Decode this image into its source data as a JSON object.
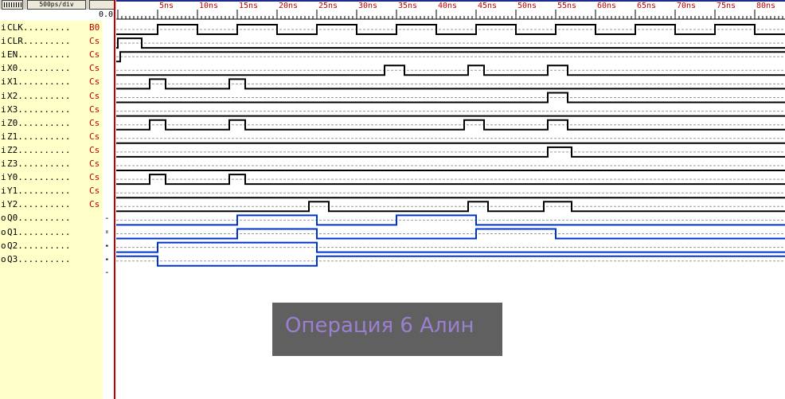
{
  "toolbar": {
    "zoom_icon": "ruler-icon",
    "timescale": "500ps/div",
    "extra_icon": "grid-icon"
  },
  "timeline": {
    "origin_label": "0.0",
    "tick_labels": [
      "5ns",
      "10ns",
      "15ns",
      "20ns",
      "25ns",
      "30ns",
      "35ns",
      "40ns",
      "45ns",
      "50ns",
      "55ns",
      "60ns",
      "65ns",
      "70ns",
      "75ns",
      "80ns"
    ],
    "ns_per_label": 5,
    "max_ns": 84
  },
  "colors": {
    "value_text": "#c00000",
    "cursor": "#c00000",
    "input_wave": "#000000",
    "output_wave": "#0033cc",
    "panel_bg": "#ffffc8",
    "watermark_bg": "#606060",
    "watermark_text": "#9b7fd0"
  },
  "signals": [
    {
      "dir": "i",
      "label": "CLK.........",
      "value": "B0",
      "mark": "",
      "kind": "input",
      "initial": 0,
      "edges": [
        5,
        10,
        15,
        20,
        25,
        30,
        35,
        40,
        45,
        50,
        55,
        60,
        65,
        70,
        75,
        80
      ]
    },
    {
      "dir": "i",
      "label": "CLR.........",
      "value": "Cs",
      "mark": "",
      "kind": "input",
      "initial": 0,
      "edges": [
        0,
        3
      ]
    },
    {
      "dir": "i",
      "label": "EN..........",
      "value": "Cs",
      "mark": "",
      "kind": "input",
      "initial": 0,
      "edges": [
        0.3
      ]
    },
    {
      "dir": "i",
      "label": "X0..........",
      "value": "Cs",
      "mark": "",
      "kind": "input",
      "initial": 0,
      "edges": [
        33.5,
        36,
        44,
        46,
        54,
        56.5
      ]
    },
    {
      "dir": "i",
      "label": "X1..........",
      "value": "Cs",
      "mark": "",
      "kind": "input",
      "initial": 0,
      "edges": [
        4,
        6,
        14,
        16
      ]
    },
    {
      "dir": "i",
      "label": "X2..........",
      "value": "Cs",
      "mark": "",
      "kind": "input",
      "initial": 0,
      "edges": [
        54,
        56.5
      ]
    },
    {
      "dir": "i",
      "label": "X3..........",
      "value": "Cs",
      "mark": "",
      "kind": "input",
      "initial": 0,
      "edges": []
    },
    {
      "dir": "i",
      "label": "Z0..........",
      "value": "Cs",
      "mark": "",
      "kind": "input",
      "initial": 0,
      "edges": [
        4,
        6,
        14,
        16,
        43.5,
        46,
        54,
        56.5
      ]
    },
    {
      "dir": "i",
      "label": "Z1..........",
      "value": "Cs",
      "mark": "",
      "kind": "input",
      "initial": 0,
      "edges": []
    },
    {
      "dir": "i",
      "label": "Z2..........",
      "value": "Cs",
      "mark": "",
      "kind": "input",
      "initial": 0,
      "edges": [
        54,
        57
      ]
    },
    {
      "dir": "i",
      "label": "Z3..........",
      "value": "Cs",
      "mark": "",
      "kind": "input",
      "initial": 0,
      "edges": []
    },
    {
      "dir": "i",
      "label": "Y0..........",
      "value": "Cs",
      "mark": "",
      "kind": "input",
      "initial": 0,
      "edges": [
        4,
        6,
        14,
        16
      ]
    },
    {
      "dir": "i",
      "label": "Y1..........",
      "value": "Cs",
      "mark": "",
      "kind": "input",
      "initial": 0,
      "edges": []
    },
    {
      "dir": "i",
      "label": "Y2..........",
      "value": "Cs",
      "mark": "",
      "kind": "input",
      "initial": 0,
      "edges": [
        24,
        26.5,
        44,
        46.5,
        53.5,
        57
      ]
    },
    {
      "dir": "o",
      "label": "Q0..........",
      "value": "",
      "mark": "--",
      "kind": "output",
      "initial": 0,
      "edges": [
        15,
        25,
        35,
        45
      ]
    },
    {
      "dir": "o",
      "label": "Q1..........",
      "value": "",
      "mark": "--",
      "kind": "output",
      "initial": 0,
      "edges": [
        15,
        25,
        45,
        55
      ]
    },
    {
      "dir": "o",
      "label": "Q2..........",
      "value": "",
      "mark": "--",
      "kind": "output",
      "initial": 0,
      "edges": [
        5,
        25
      ]
    },
    {
      "dir": "o",
      "label": "Q3..........",
      "value": "",
      "mark": "--",
      "kind": "output",
      "initial": 1,
      "edges": [
        5,
        25
      ]
    }
  ],
  "watermark": {
    "text": "Операция 6 Алин"
  }
}
